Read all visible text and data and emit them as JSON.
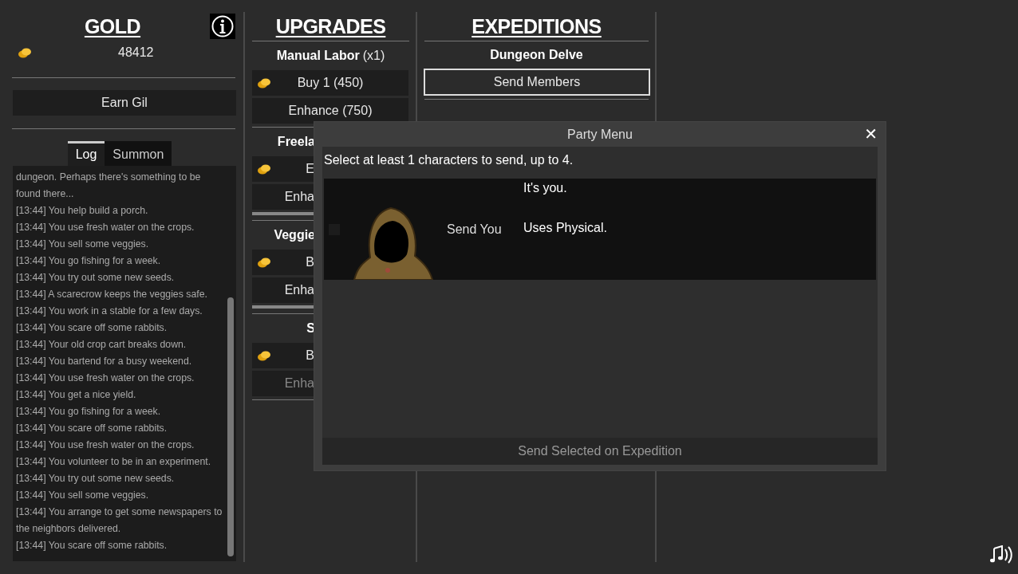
{
  "gold": {
    "title": "GOLD",
    "amount": "48412"
  },
  "earn_button": {
    "label": "Earn Gil"
  },
  "log_tabs": [
    {
      "label": "Log",
      "selected": true
    },
    {
      "label": "Summon",
      "selected": false
    }
  ],
  "log": [
    "dungeon. Perhaps there's something to be found there...",
    "[13:44] You help build a porch.",
    "[13:44] You use fresh water on the crops.",
    "[13:44] You sell some veggies.",
    "[13:44] You go fishing for a week.",
    "[13:44] You try out some new seeds.",
    "[13:44] A scarecrow keeps the veggies safe.",
    "[13:44] You work in a stable for a few days.",
    "[13:44] You scare off some rabbits.",
    "[13:44] Your old crop cart breaks down.",
    "[13:44] You bartend for a busy weekend.",
    "[13:44] You use fresh water on the crops.",
    "[13:44] You get a nice yield.",
    "[13:44] You go fishing for a week.",
    "[13:44] You scare off some rabbits.",
    "[13:44] You use fresh water on the crops.",
    "[13:44] You volunteer to be in an experiment.",
    "[13:44] You try out some new seeds.",
    "[13:44] You sell some veggies.",
    "[13:44] You arrange to get some newspapers to the neighbors delivered.",
    "[13:44] You scare off some rabbits."
  ],
  "upgrades": {
    "title": "UPGRADES",
    "items": [
      {
        "name": "Manual Labor",
        "count": "(x1)",
        "buy": "Buy 1 (450)",
        "enhance": "Enhance (750)",
        "enhance_disabled": false
      },
      {
        "name": "Freela",
        "buy": "E",
        "enhance": "Enha",
        "enhance_disabled": false
      },
      {
        "name": "Veggie",
        "buy": "B",
        "enhance": "Enha",
        "enhance_disabled": false
      },
      {
        "name": "S",
        "buy": "B",
        "enhance": "Enha",
        "enhance_disabled": true
      }
    ]
  },
  "expeditions": {
    "title": "EXPEDITIONS",
    "items": [
      {
        "name": "Dungeon Delve",
        "button": "Send Members",
        "selected": true
      }
    ]
  },
  "party_menu": {
    "title": "Party Menu",
    "close": "✕",
    "instructions": "Select at least 1 characters to send, up to 4.",
    "characters": [
      {
        "action": "Send You",
        "description": "It's you.",
        "skill": "Uses Physical.",
        "selected": false
      }
    ],
    "send_button": {
      "label": "Send Selected on Expedition",
      "disabled": true
    }
  }
}
